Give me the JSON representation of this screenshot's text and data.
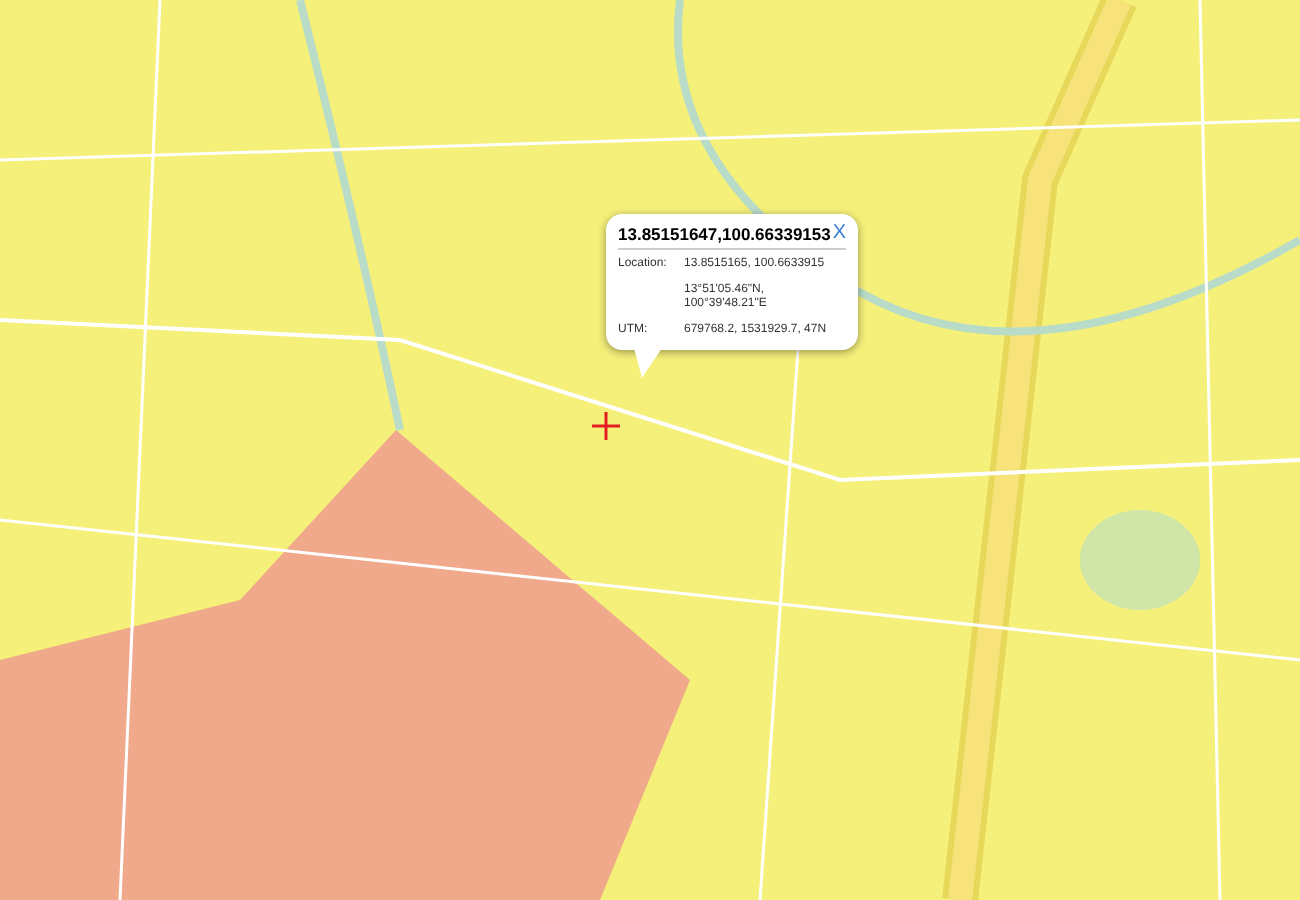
{
  "popup": {
    "title": "13.85151647,100.66339153",
    "close": "X",
    "rows": [
      {
        "label": "Location:",
        "lines": [
          "13.8515165, 100.6633915"
        ]
      },
      {
        "lines": [
          "13°51'05.46\"N,",
          "100°39'48.21\"E"
        ]
      },
      {
        "label": "UTM:",
        "lines": [
          "679768.2, 1531929.7, 47N"
        ]
      }
    ]
  }
}
